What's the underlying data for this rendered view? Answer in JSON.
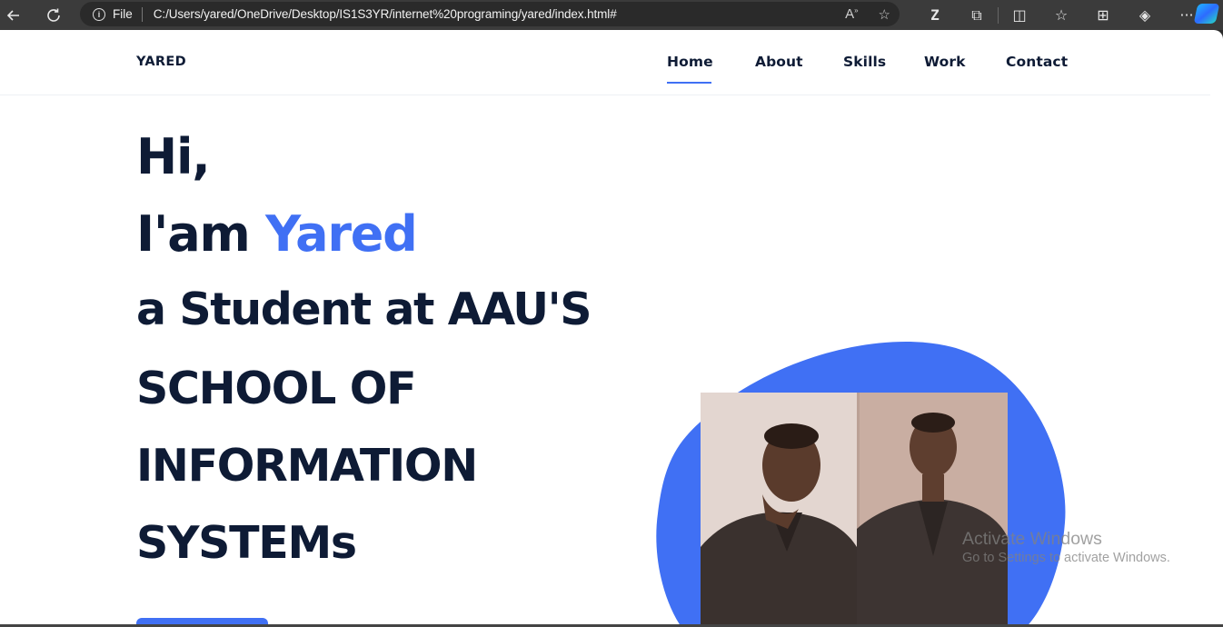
{
  "browser": {
    "file_label": "File",
    "url": "C:/Users/yared/OneDrive/Desktop/IS1S3YR/internet%20programing/yared/index.html#",
    "address_icons": [
      "read-aloud-icon",
      "favorite-star-icon"
    ],
    "toolbar_icons": [
      "z-extension-icon",
      "extensions-icon",
      "split-screen-icon",
      "favorites-icon",
      "collections-icon",
      "browser-essentials-icon",
      "more-icon",
      "copilot-icon"
    ],
    "colors": {
      "chrome": "#3b3b3b",
      "address_bg": "#2a2a2a"
    }
  },
  "site": {
    "logo": "YARED",
    "nav": [
      "Home",
      "About",
      "Skills",
      "Work",
      "Contact"
    ],
    "active_nav": "Home",
    "hero": {
      "line1": "Hi,",
      "line2_prefix": "I'am ",
      "name": "Yared",
      "line3": "a Student at AAU'S",
      "line4": "SCHOOL OF",
      "line5": "INFORMATION",
      "line6": "SYSTEMs"
    },
    "colors": {
      "accent": "#4070f4",
      "text": "#0e1b35"
    }
  },
  "watermark": {
    "title": "Activate Windows",
    "subtitle": "Go to Settings to activate Windows."
  }
}
